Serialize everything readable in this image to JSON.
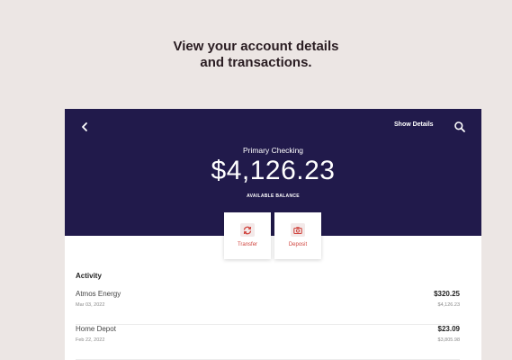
{
  "headline": {
    "line1": "View your account details",
    "line2": "and transactions."
  },
  "colors": {
    "background": "#ece6e4",
    "hero": "#211a4b",
    "accent": "#d0443e"
  },
  "header": {
    "back_icon": "chevron-left-icon",
    "show_details_label": "Show Details",
    "search_icon": "search-icon"
  },
  "account": {
    "name": "Primary Checking",
    "balance": "$4,126.23",
    "balance_label": "AVAILABLE BALANCE"
  },
  "actions": [
    {
      "label": "Transfer",
      "icon": "transfer-icon"
    },
    {
      "label": "Deposit",
      "icon": "camera-icon"
    }
  ],
  "activity": {
    "title": "Activity",
    "transactions": [
      {
        "name": "Atmos Energy",
        "date": "Mar 03, 2022",
        "amount": "$320.25",
        "balance": "$4,126.23"
      },
      {
        "name": "Home Depot",
        "date": "Feb 22, 2022",
        "amount": "$23.09",
        "balance": "$3,805.98"
      }
    ]
  }
}
